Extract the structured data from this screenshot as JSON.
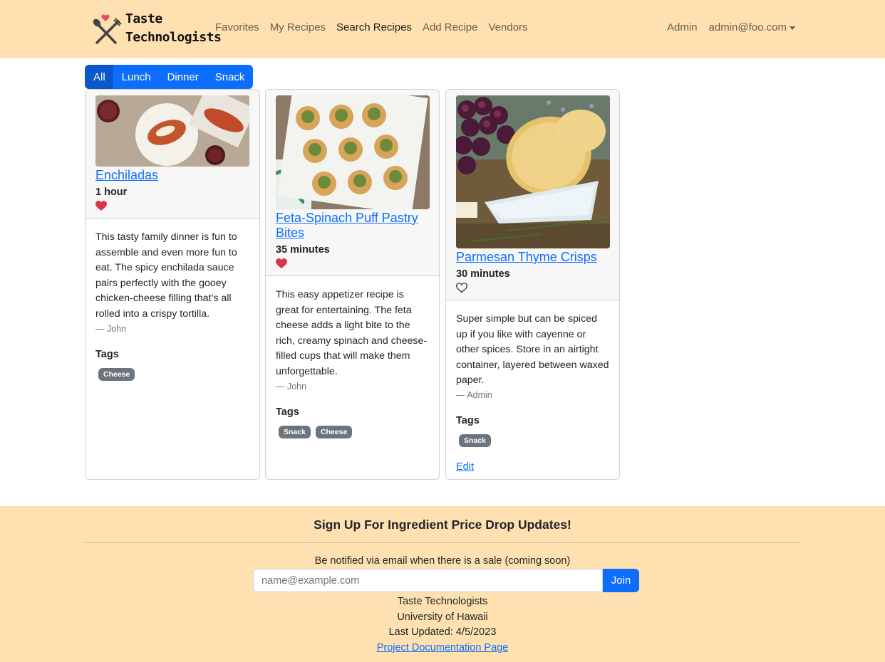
{
  "navbar": {
    "brand_line1": "Taste",
    "brand_line2": "Technologists",
    "links": {
      "favorites": "Favorites",
      "my_recipes": "My Recipes",
      "search_recipes": "Search Recipes",
      "add_recipe": "Add Recipe",
      "vendors": "Vendors"
    },
    "admin": "Admin",
    "user": "admin@foo.com"
  },
  "filters": {
    "all": "All",
    "lunch": "Lunch",
    "dinner": "Dinner",
    "snack": "Snack",
    "selected": "All"
  },
  "recipes": [
    {
      "title": "Enchiladas",
      "time": "1 hour",
      "favorited": true,
      "description": "This tasty family dinner is fun to assemble and even more fun to eat. The spicy enchilada sauce pairs perfectly with the gooey chicken-cheese filling that’s all rolled into a crispy tortilla.",
      "author": "— John",
      "tags_label": "Tags",
      "tags": [
        "Cheese"
      ]
    },
    {
      "title": "Feta-Spinach Puff Pastry Bites",
      "time": "35 minutes",
      "favorited": true,
      "description": "This easy appetizer recipe is great for entertaining. The feta cheese adds a light bite to the rich, creamy spinach and cheese-filled cups that will make them unforgettable.",
      "author": "— John",
      "tags_label": "Tags",
      "tags": [
        "Snack",
        "Cheese"
      ]
    },
    {
      "title": "Parmesan Thyme Crisps",
      "time": "30 minutes",
      "favorited": false,
      "description": "Super simple but can be spiced up if you like with cayenne or other spices. Store in an airtight container, layered between waxed paper.",
      "author": "— Admin",
      "tags_label": "Tags",
      "tags": [
        "Snack"
      ],
      "edit_label": "Edit"
    }
  ],
  "footer": {
    "signup_title": "Sign Up For Ingredient Price Drop Updates!",
    "signup_note": "Be notified via email when there is a sale (coming soon)",
    "email_placeholder": "name@example.com",
    "join_label": "Join",
    "org": "Taste Technologists",
    "university": "University of Hawaii",
    "last_updated": "Last Updated: 4/5/2023",
    "docs_link": "Project Documentation Page"
  },
  "colors": {
    "navbar_bg": "#ffe0b0",
    "primary": "#0d6efd",
    "heart_filled": "#dc3545",
    "badge": "#6c757d"
  }
}
